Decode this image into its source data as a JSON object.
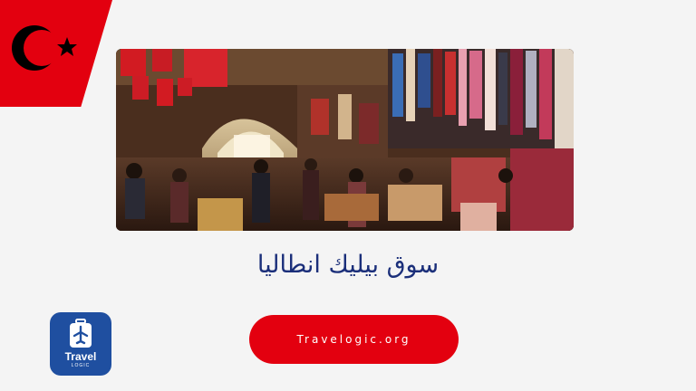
{
  "page": {
    "title": "سوق بيليك انطاليا",
    "cta_label": "Travelogic.org"
  },
  "logo": {
    "brand": "Travel",
    "sub": "LOGIC"
  },
  "hero": {
    "image": "crowded covered market street in Antalya with hanging textiles and Turkish flags"
  },
  "colors": {
    "accent_red": "#e3000f",
    "title_blue": "#1b2f7a",
    "logo_blue": "#1f4fa0",
    "background": "#f4f4f4"
  },
  "icons": {
    "flag": "turkish-flag-icon",
    "logo_mark": "luggage-airplane-icon"
  }
}
